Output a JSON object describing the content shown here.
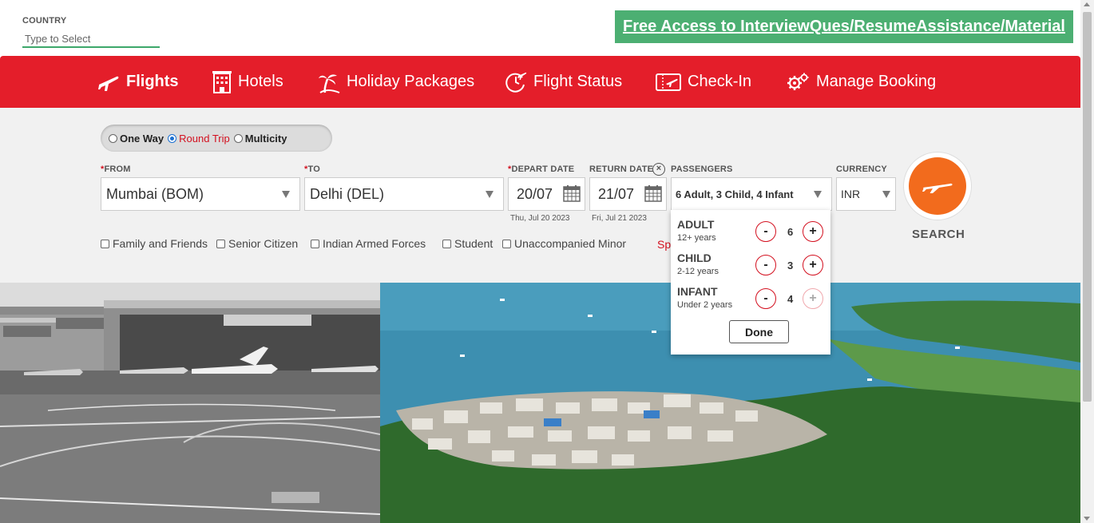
{
  "country": {
    "label": "COUNTRY",
    "placeholder": "Type to Select"
  },
  "promo": {
    "text": "Free Access to InterviewQues/ResumeAssistance/Material"
  },
  "nav": {
    "items": [
      {
        "label": "Flights",
        "icon": "plane-icon",
        "active": true
      },
      {
        "label": "Hotels",
        "icon": "hotel-icon"
      },
      {
        "label": "Holiday Packages",
        "icon": "palm-tree-icon"
      },
      {
        "label": "Flight Status",
        "icon": "flight-status-icon"
      },
      {
        "label": "Check-In",
        "icon": "boarding-pass-icon"
      },
      {
        "label": "Manage Booking",
        "icon": "gears-icon"
      }
    ]
  },
  "trip_type": {
    "options": [
      {
        "label": "One Way",
        "selected": false
      },
      {
        "label": "Round Trip",
        "selected": true
      },
      {
        "label": "Multicity",
        "selected": false
      }
    ]
  },
  "from": {
    "label": "FROM",
    "value": "Mumbai (BOM)"
  },
  "to": {
    "label": "TO",
    "value": "Delhi (DEL)"
  },
  "depart": {
    "label": "DEPART DATE",
    "value": "20/07",
    "sub": "Thu, Jul 20 2023"
  },
  "return": {
    "label": "RETURN DATE",
    "value": "21/07",
    "sub": "Fri, Jul 21 2023"
  },
  "passengers": {
    "label": "PASSENGERS",
    "summary": "6 Adult, 3 Child, 4 Infant",
    "rows": [
      {
        "name": "ADULT",
        "hint": "12+ years",
        "count": "6",
        "minus": "-",
        "plus": "+"
      },
      {
        "name": "CHILD",
        "hint": "2-12 years",
        "count": "3",
        "minus": "-",
        "plus": "+"
      },
      {
        "name": "INFANT",
        "hint": "Under 2 years",
        "count": "4",
        "minus": "-",
        "plus": "+",
        "plus_disabled": true
      }
    ],
    "done_label": "Done"
  },
  "currency": {
    "label": "CURRENCY",
    "value": "INR"
  },
  "search": {
    "label": "SEARCH"
  },
  "special_fares": {
    "options": [
      "Family and Friends",
      "Senior Citizen",
      "Indian Armed Forces",
      "Student",
      "Unaccompanied Minor"
    ],
    "partial_link": "Sp"
  },
  "colors": {
    "brand_red": "#e41e2a",
    "search_orange": "#f26b1d",
    "promo_green": "#4caf72"
  }
}
